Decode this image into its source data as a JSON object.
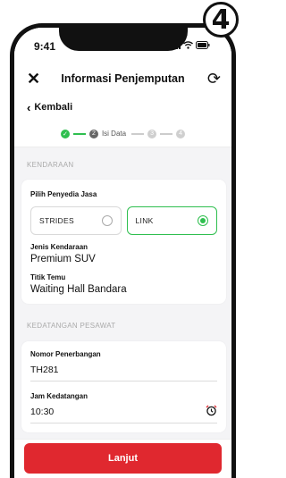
{
  "badge": "4",
  "status": {
    "time": "9:41"
  },
  "header": {
    "close_icon": "close-icon",
    "title": "Informasi Penjemputan",
    "refresh_icon": "refresh-icon"
  },
  "back": {
    "label": "Kembali"
  },
  "stepper": {
    "active_label": "Isi Data",
    "step2": "2",
    "step3": "3",
    "step4": "4"
  },
  "vehicle": {
    "section_title": "KENDARAAN",
    "provider_label": "Pilih Penyedia Jasa",
    "providers": [
      {
        "name": "STRIDES",
        "selected": false
      },
      {
        "name": "LINK",
        "selected": true
      }
    ],
    "type_label": "Jenis Kendaraan",
    "type_value": "Premium SUV",
    "meet_label": "Titik Temu",
    "meet_value": "Waiting Hall Bandara"
  },
  "arrival": {
    "section_title": "KEDATANGAN PESAWAT",
    "flight_label": "Nomor Penerbangan",
    "flight_value": "TH281",
    "time_label": "Jam Kedatangan",
    "time_value": "10:30"
  },
  "cta": {
    "label": "Lanjut"
  },
  "colors": {
    "accent": "#e0282f",
    "success": "#2fbf4f"
  }
}
